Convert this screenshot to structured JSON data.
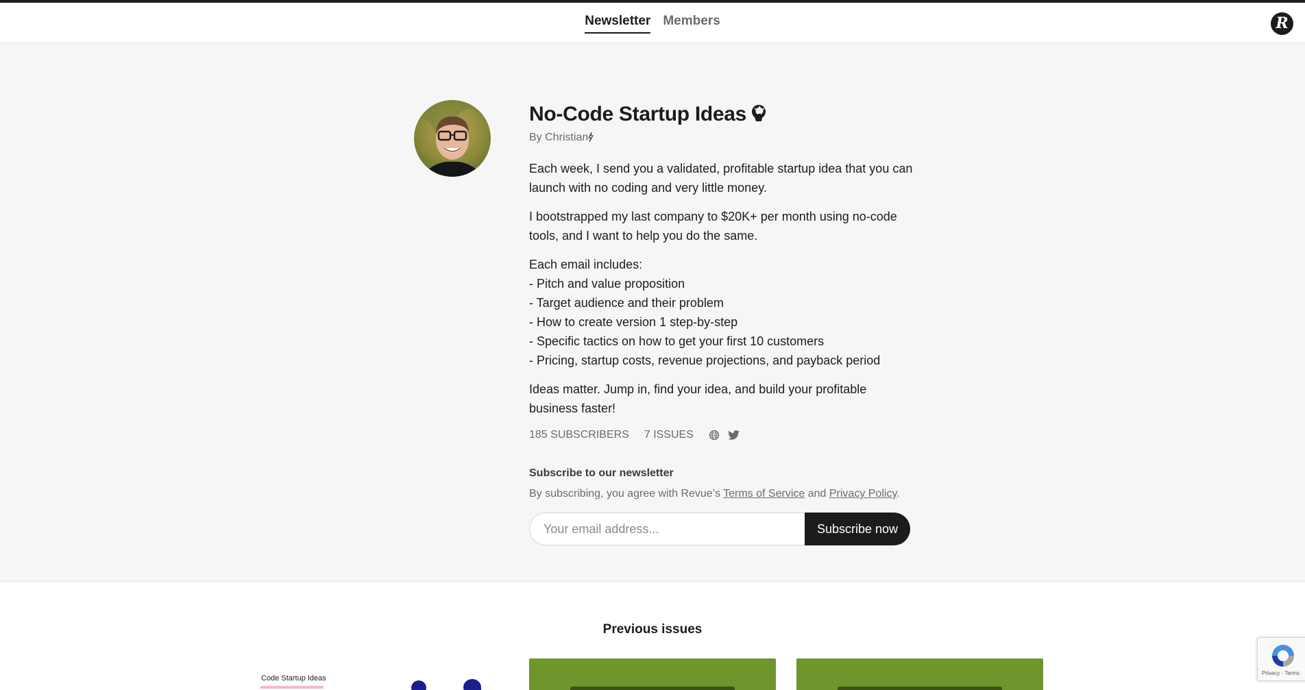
{
  "nav": {
    "items": [
      {
        "label": "Newsletter",
        "active": true
      },
      {
        "label": "Members",
        "active": false
      }
    ],
    "logo_icon": "revue-logo-icon",
    "logo_letter": "R"
  },
  "profile": {
    "title": "No-Code Startup Ideas",
    "title_emoji_icon": "lightbulb-head-icon",
    "byline": "By Christian",
    "byline_icon": "lightning-icon",
    "description": [
      "Each week, I send you a validated, profitable startup idea that you can launch with no coding and very little money.",
      "I bootstrapped my last company to $20K+ per month using no-code tools, and I want to help you do the same.",
      "Each email includes:",
      "- Pitch and value proposition",
      "- Target audience and their problem",
      "- How to create version 1 step-by-step",
      "- Specific tactics on how to get your first 10 customers",
      "- Pricing, startup costs, revenue projections, and payback period",
      "Ideas matter. Jump in, find your idea, and build your profitable business faster!"
    ],
    "stats": {
      "subscribers": "185 SUBSCRIBERS",
      "issues": "7 ISSUES"
    },
    "links": [
      "globe-icon",
      "twitter-icon"
    ]
  },
  "subscribe": {
    "title": "Subscribe to our newsletter",
    "note_prefix": "By subscribing, you agree with Revue’s ",
    "terms_label": "Terms of Service",
    "note_mid": " and ",
    "privacy_label": "Privacy Policy",
    "note_suffix": ".",
    "email_placeholder": "Your email address...",
    "email_value": "",
    "button_label": "Subscribe now"
  },
  "previous": {
    "title": "Previous issues",
    "cards": [
      {
        "thumbnail_label": "Code Startup Ideas"
      },
      {
        "thumbnail_label": ""
      },
      {
        "thumbnail_label": ""
      }
    ]
  },
  "recaptcha": {
    "footer": "Privacy - Terms"
  },
  "colors": {
    "accent": "#1c1c1c",
    "page_background": "#f6f6f6",
    "muted_text": "#6b6b6b",
    "card_green": "#6f952d",
    "thumbnail_blue": "#1b1e8f"
  }
}
